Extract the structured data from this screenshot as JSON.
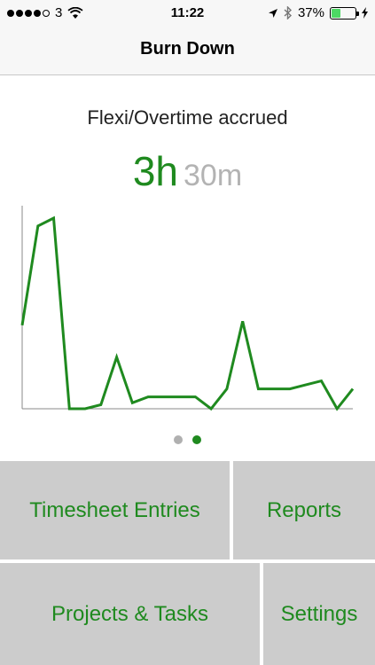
{
  "status_bar": {
    "carrier": "3",
    "time": "11:22",
    "battery_percent": "37%",
    "battery_level": 0.37,
    "icons": [
      "signal-dots-icon",
      "wifi-icon",
      "location-arrow-icon",
      "bluetooth-icon",
      "battery-icon",
      "charging-bolt-icon"
    ]
  },
  "nav": {
    "title": "Burn Down"
  },
  "summary": {
    "label": "Flexi/Overtime accrued",
    "hours": "3h",
    "minutes": "30m"
  },
  "colors": {
    "accent": "#1f8a1f",
    "tile_bg": "#cccccc",
    "muted": "#b3b3b3"
  },
  "chart_data": {
    "type": "line",
    "title": "",
    "xlabel": "",
    "ylabel": "",
    "color": "#1f8a1f",
    "x": [
      0,
      1,
      2,
      3,
      4,
      5,
      6,
      7,
      8,
      9,
      10,
      11,
      12,
      13,
      14,
      15,
      16,
      17,
      18,
      19,
      20,
      21,
      22
    ],
    "values": [
      42,
      92,
      96,
      0,
      0,
      2,
      26,
      3,
      6,
      6,
      6,
      6,
      0,
      10,
      44,
      10,
      10,
      10,
      12,
      14,
      0,
      10
    ],
    "ylim": [
      0,
      100
    ],
    "grid": false
  },
  "pager": {
    "pages": 2,
    "active_index": 1
  },
  "menu": {
    "timesheet_label": "Timesheet Entries",
    "reports_label": "Reports",
    "projects_label": "Projects & Tasks",
    "settings_label": "Settings"
  }
}
